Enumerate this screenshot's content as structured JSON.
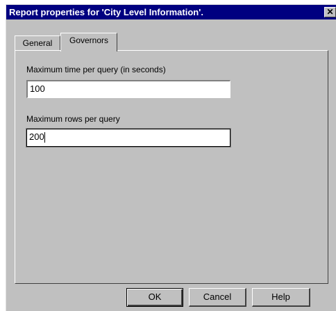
{
  "window": {
    "title": "Report properties for 'City Level Information'.",
    "close_glyph": "✕"
  },
  "tabs": [
    {
      "label": "General",
      "selected": false
    },
    {
      "label": "Governors",
      "selected": true
    }
  ],
  "governors": {
    "max_time_label": "Maximum time per query (in seconds)",
    "max_time_value": "100",
    "max_rows_label": "Maximum rows per query",
    "max_rows_value": "200"
  },
  "buttons": {
    "ok": "OK",
    "cancel": "Cancel",
    "help": "Help"
  }
}
